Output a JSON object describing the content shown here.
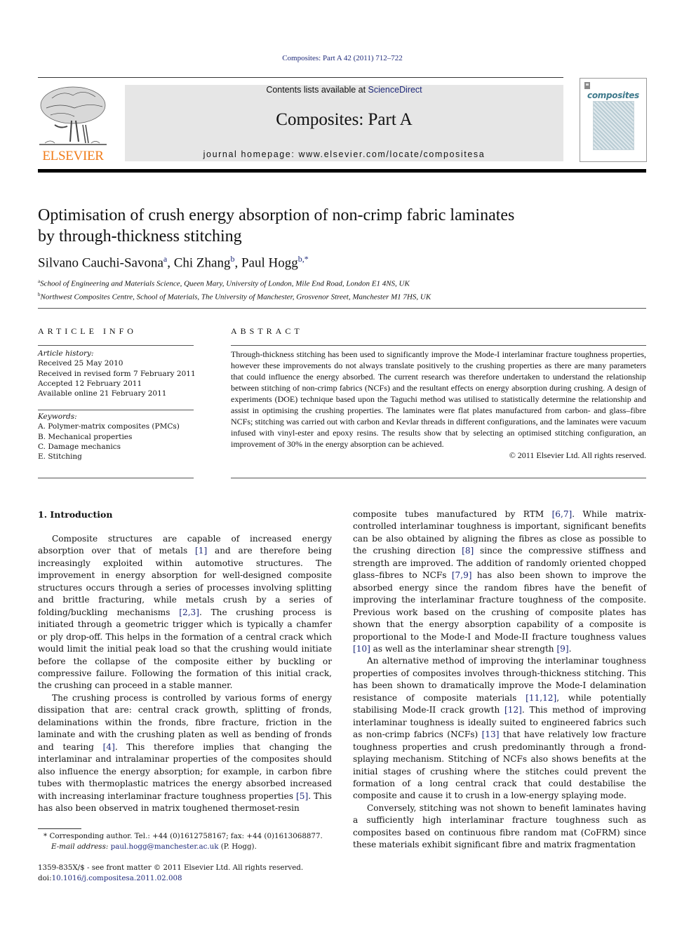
{
  "running_header": "Composites: Part A 42 (2011) 712–722",
  "publisher": {
    "name": "ELSEVIER",
    "brand_color": "#f07c1a"
  },
  "masthead": {
    "contents_prefix": "Contents lists available at ",
    "contents_link": "ScienceDirect",
    "journal_title": "Composites: Part A",
    "homepage": "journal homepage: www.elsevier.com/locate/compositesa"
  },
  "cover": {
    "wordmark": "composites"
  },
  "article": {
    "title_line1": "Optimisation of crush energy absorption of non-crimp fabric laminates",
    "title_line2": "by through-thickness stitching",
    "authors": [
      {
        "name": "Silvano Cauchi-Savona",
        "sup": "a"
      },
      {
        "name": "Chi Zhang",
        "sup": "b"
      },
      {
        "name": "Paul Hogg",
        "sup": "b,*"
      }
    ],
    "affiliations": [
      {
        "key": "a",
        "text": "School of Engineering and Materials Science, Queen Mary, University of London, Mile End Road, London E1 4NS, UK"
      },
      {
        "key": "b",
        "text": "Northwest Composites Centre, School of Materials, The University of Manchester, Grosvenor Street, Manchester M1 7HS, UK"
      }
    ]
  },
  "article_info": {
    "heading": "ARTICLE INFO",
    "history_label": "Article history:",
    "history": [
      "Received 25 May 2010",
      "Received in revised form 7 February 2011",
      "Accepted 12 February 2011",
      "Available online 21 February 2011"
    ],
    "keywords_label": "Keywords:",
    "keywords": [
      "A. Polymer-matrix composites (PMCs)",
      "B. Mechanical properties",
      "C. Damage mechanics",
      "E. Stitching"
    ]
  },
  "abstract": {
    "heading": "ABSTRACT",
    "text": "Through-thickness stitching has been used to significantly improve the Mode-I interlaminar fracture toughness properties, however these improvements do not always translate positively to the crushing properties as there are many parameters that could influence the energy absorbed. The current research was therefore undertaken to understand the relationship between stitching of non-crimp fabrics (NCFs) and the resultant effects on energy absorption during crushing. A design of experiments (DOE) technique based upon the Taguchi method was utilised to statistically determine the relationship and assist in optimising the crushing properties. The laminates were flat plates manufactured from carbon- and glass–fibre NCFs; stitching was carried out with carbon and Kevlar threads in different configurations, and the laminates were vacuum infused with vinyl-ester and epoxy resins. The results show that by selecting an optimised stitching configuration, an improvement of 30% in the energy absorption can be achieved.",
    "copyright": "© 2011 Elsevier Ltd. All rights reserved."
  },
  "body": {
    "section_heading": "1. Introduction",
    "left_column": [
      [
        {
          "t": "Composite structures are capable of increased energy absorption over that of metals "
        },
        {
          "ref": "[1]"
        },
        {
          "t": " and are therefore being increasingly exploited within automotive structures. The improvement in energy absorption for well-designed composite structures occurs through a series of processes involving splitting and brittle fracturing, while metals crush by a series of folding/buckling mechanisms "
        },
        {
          "ref": "[2,3]"
        },
        {
          "t": ". The crushing process is initiated through a geometric trigger which is typically a chamfer or ply drop-off. This helps in the formation of a central crack which would limit the initial peak load so that the crushing would initiate before the collapse of the composite either by buckling or compressive failure. Following the formation of this initial crack, the crushing can proceed in a stable manner."
        }
      ],
      [
        {
          "t": "The crushing process is controlled by various forms of energy dissipation that are: central crack growth, splitting of fronds, delaminations within the fronds, fibre fracture, friction in the laminate and with the crushing platen as well as bending of fronds and tearing "
        },
        {
          "ref": "[4]"
        },
        {
          "t": ". This therefore implies that changing the interlaminar and intralaminar properties of the composites should also influence the energy absorption; for example, in carbon fibre tubes with thermoplastic matrices the energy absorbed increased with increasing interlaminar fracture toughness properties "
        },
        {
          "ref": "[5]"
        },
        {
          "t": ". This has also been observed in matrix toughened thermoset-resin"
        }
      ]
    ],
    "right_column": [
      [
        {
          "t": "composite tubes manufactured by RTM "
        },
        {
          "ref": "[6,7]"
        },
        {
          "t": ". While matrix-controlled interlaminar toughness is important, significant benefits can be also obtained by aligning the fibres as close as possible to the crushing direction "
        },
        {
          "ref": "[8]"
        },
        {
          "t": " since the compressive stiffness and strength are improved. The addition of randomly oriented chopped glass–fibres to NCFs "
        },
        {
          "ref": "[7,9]"
        },
        {
          "t": " has also been shown to improve the absorbed energy since the random fibres have the benefit of improving the interlaminar fracture toughness of the composite. Previous work based on the crushing of composite plates has shown that the energy absorption capability of a composite is proportional to the Mode-I and Mode-II fracture toughness values "
        },
        {
          "ref": "[10]"
        },
        {
          "t": " as well as the interlaminar shear strength "
        },
        {
          "ref": "[9]"
        },
        {
          "t": "."
        }
      ],
      [
        {
          "t": "An alternative method of improving the interlaminar toughness properties of composites involves through-thickness stitching. This has been shown to dramatically improve the Mode-I delamination resistance of composite materials "
        },
        {
          "ref": "[11,12]"
        },
        {
          "t": ", while potentially stabilising Mode-II crack growth "
        },
        {
          "ref": "[12]"
        },
        {
          "t": ". This method of improving interlaminar toughness is ideally suited to engineered fabrics such as non-crimp fabrics (NCFs) "
        },
        {
          "ref": "[13]"
        },
        {
          "t": " that have relatively low fracture toughness properties and crush predominantly through a frond-splaying mechanism. Stitching of NCFs also shows benefits at the initial stages of crushing where the stitches could prevent the formation of a long central crack that could destabilise the composite and cause it to crush in a low-energy splaying mode."
        }
      ],
      [
        {
          "t": "Conversely, stitching was not shown to benefit laminates having a sufficiently high interlaminar fracture toughness such as composites based on continuous fibre random mat (CoFRM) since these materials exhibit significant fibre and matrix fragmentation"
        }
      ]
    ]
  },
  "footnote": {
    "marker": "*",
    "corresponding": "Corresponding author. Tel.: +44 (0)1612758167; fax: +44 (0)1613068877.",
    "email_label": "E-mail address:",
    "email": "paul.hogg@manchester.ac.uk",
    "email_suffix": " (P. Hogg)."
  },
  "front_matter": {
    "issn_line": "1359-835X/$ - see front matter © 2011 Elsevier Ltd. All rights reserved.",
    "doi_prefix": "doi:",
    "doi": "10.1016/j.compositesa.2011.02.008"
  },
  "colors": {
    "link": "#1f2a7a",
    "masthead_bg": "#e6e6e6",
    "cover_accent": "#3f7a8c"
  }
}
